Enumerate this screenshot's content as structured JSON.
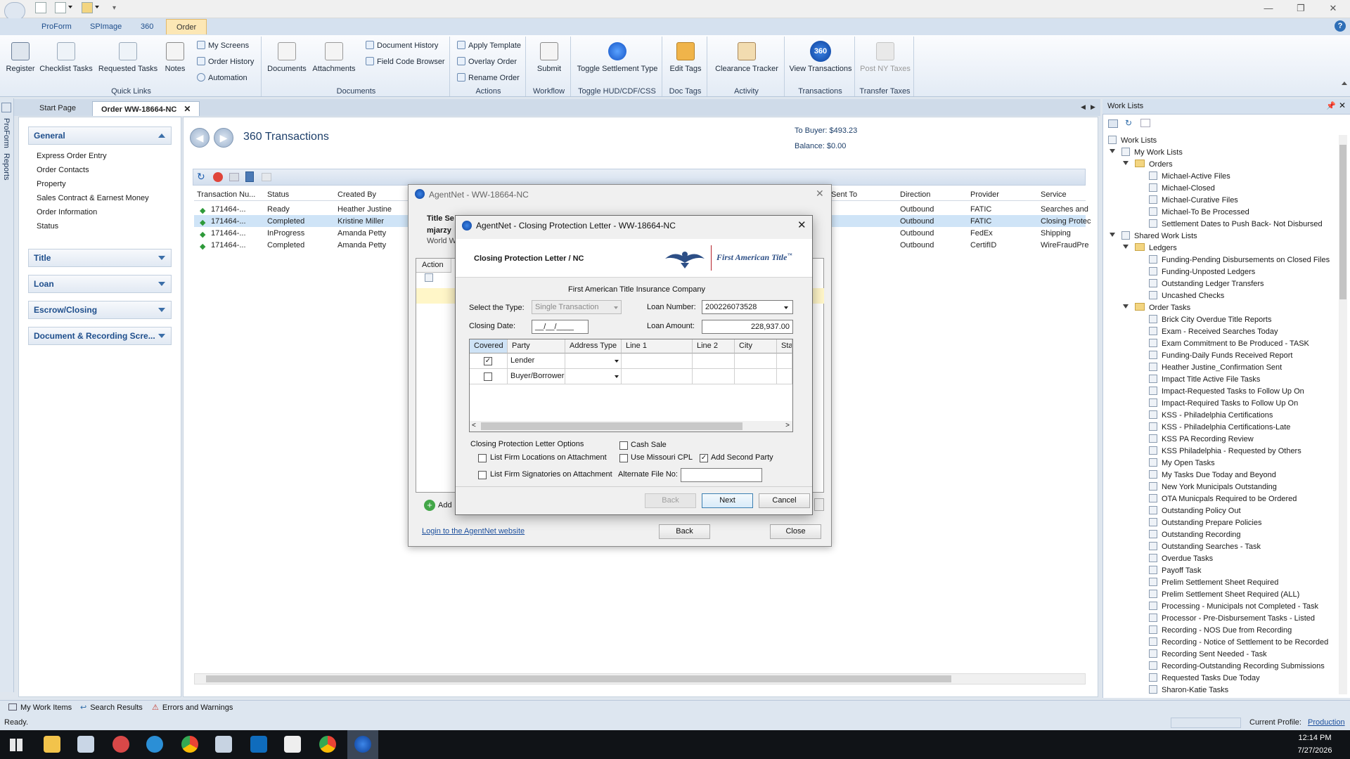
{
  "ribbon": {
    "tabs": [
      "ProForm",
      "SPImage",
      "360",
      "Order"
    ],
    "active_tab": "Order",
    "groups": {
      "quick_links": {
        "label": "Quick Links",
        "register": "Register",
        "checklist": "Checklist Tasks",
        "requested": "Requested Tasks",
        "notes": "Notes",
        "my_screens": "My Screens",
        "order_history": "Order History",
        "automation": "Automation"
      },
      "documents": {
        "label": "Documents",
        "documents": "Documents",
        "attachments": "Attachments",
        "doc_history": "Document History",
        "field_code": "Field Code Browser"
      },
      "actions": {
        "label": "Actions",
        "apply_template": "Apply Template",
        "overlay_order": "Overlay Order",
        "rename_order": "Rename Order"
      },
      "workflow": {
        "label": "Workflow",
        "submit": "Submit"
      },
      "toggle": {
        "label": "Toggle HUD/CDF/CSS",
        "toggle_settlement": "Toggle Settlement Type"
      },
      "doc_tags": {
        "label": "Doc Tags",
        "edit_tags": "Edit Tags"
      },
      "activity": {
        "label": "Activity",
        "clearance": "Clearance Tracker"
      },
      "transactions": {
        "label": "Transactions",
        "view": "View Transactions",
        "badge": "360"
      },
      "transfer": {
        "label": "Transfer Taxes",
        "post_ny": "Post NY Taxes"
      }
    }
  },
  "side_strip": {
    "proform": "ProForm",
    "reports": "Reports"
  },
  "doc_tabs": {
    "start": "Start Page",
    "order": "Order WW-18664-NC"
  },
  "left_panel": {
    "general": "General",
    "general_items": [
      "Express Order Entry",
      "Order Contacts",
      "Property",
      "Sales Contract & Earnest Money",
      "Order Information",
      "Status"
    ],
    "sections": [
      "Title",
      "Loan",
      "Escrow/Closing",
      "Document & Recording Scre..."
    ]
  },
  "main": {
    "title": "360 Transactions",
    "to_buyer": "To Buyer: $493.23",
    "balance": "Balance: $0.00",
    "columns": {
      "num": "Transaction Nu...",
      "status": "Status",
      "created": "Created By",
      "sent_to": "Sent To",
      "direction": "Direction",
      "provider": "Provider",
      "service": "Service"
    },
    "rows": [
      {
        "num": "171464-...",
        "status": "Ready",
        "created": "Heather Justine",
        "direction": "Outbound",
        "provider": "FATIC",
        "service": "Searches and"
      },
      {
        "num": "171464-...",
        "status": "Completed",
        "created": "Kristine Miller",
        "direction": "Outbound",
        "provider": "FATIC",
        "service": "Closing Protec"
      },
      {
        "num": "171464-...",
        "status": "InProgress",
        "created": "Amanda Petty",
        "direction": "Outbound",
        "provider": "FedEx",
        "service": "Shipping"
      },
      {
        "num": "171464-...",
        "status": "Completed",
        "created": "Amanda Petty",
        "direction": "Outbound",
        "provider": "CertifID",
        "service": "WireFraudPre"
      }
    ]
  },
  "agentnet_bg": {
    "title": "AgentNet - WW-18664-NC",
    "title_se": "Title Se",
    "user": "mjarzy",
    "world": "World W",
    "action_col": "Action",
    "add": "Add",
    "login_link": "Login to the AgentNet website",
    "back": "Back",
    "close": "Close"
  },
  "cpl_dialog": {
    "title": "AgentNet - Closing Protection Letter - WW-18664-NC",
    "header": "Closing Protection Letter  /  NC",
    "logo_text": "First American Title",
    "logo_tm": "™",
    "company": "First American Title Insurance Company",
    "type_label": "Select the Type:",
    "type_value": "Single Transaction",
    "loan_number_label": "Loan Number:",
    "loan_number": "200226073528",
    "closing_date_label": "Closing Date:",
    "closing_date": "__/__/____",
    "loan_amount_label": "Loan Amount:",
    "loan_amount": "228,937.00",
    "grid_cols": [
      "Covered",
      "Party",
      "Address Type",
      "Line 1",
      "Line 2",
      "City",
      "Sta"
    ],
    "grid_rows": [
      {
        "covered": true,
        "party": "Lender"
      },
      {
        "covered": false,
        "party": "Buyer/Borrower"
      }
    ],
    "options_label": "Closing Protection Letter Options",
    "opt_firm_locations": "List Firm Locations on Attachment",
    "opt_firm_signatories": "List Firm Signatories on Attachment",
    "opt_cash_sale": "Cash Sale",
    "opt_missouri": "Use Missouri CPL",
    "opt_second_party": "Add Second Party",
    "alt_file_label": "Alternate File No:",
    "back": "Back",
    "next": "Next",
    "cancel": "Cancel"
  },
  "work_lists": {
    "panel_title": "Work Lists",
    "root": "Work Lists",
    "my_work_lists": "My Work Lists",
    "orders": "Orders",
    "order_items": [
      "Michael-Active Files",
      "Michael-Closed",
      "Michael-Curative Files",
      "Michael-To Be Processed",
      "Settlement Dates to Push Back- Not Disbursed"
    ],
    "shared": "Shared Work Lists",
    "ledgers": "Ledgers",
    "ledger_items": [
      "Funding-Pending Disbursements on Closed Files",
      "Funding-Unposted Ledgers",
      "Outstanding Ledger Transfers",
      "Uncashed Checks"
    ],
    "order_tasks": "Order Tasks",
    "task_items": [
      "Brick City Overdue Title Reports",
      "Exam - Received Searches Today",
      "Exam Commitment to Be Produced - TASK",
      "Funding-Daily Funds Received Report",
      "Heather Justine_Confirmation Sent",
      "Impact Title Active File Tasks",
      "Impact-Requested Tasks to Follow Up On",
      "Impact-Required Tasks to Follow Up On",
      "KSS - Philadelphia Certifications",
      "KSS - Philadelphia Certifications-Late",
      "KSS PA Recording Review",
      "KSS Philadelphia - Requested by Others",
      "My Open Tasks",
      "My Tasks Due Today and Beyond",
      "New York Municipals Outstanding",
      "OTA Municpals Required to be Ordered",
      "Outstanding Policy Out",
      "Outstanding Prepare Policies",
      "Outstanding Recording",
      "Outstanding Searches - Task",
      "Overdue Tasks",
      "Payoff Task",
      "Prelim Settlement Sheet Required",
      "Prelim Settlement Sheet Required (ALL)",
      "Processing - Municipals not Completed - Task",
      "Processor - Pre-Disbursement Tasks - Listed",
      "Recording - NOS Due from Recording",
      "Recording - Notice of Settlement to be Recorded",
      "Recording Sent Needed - Task",
      "Recording-Outstanding Recording Submissions",
      "Requested Tasks Due Today",
      "Sharon-Katie Tasks"
    ]
  },
  "bottom": {
    "my_work_items": "My Work Items",
    "search_results": "Search Results",
    "errors": "Errors and Warnings",
    "status": "Ready.",
    "profile_label": "Current Profile:",
    "profile": "Production"
  },
  "taskbar": {
    "time": "12:14 PM",
    "date": "7/27/2026"
  }
}
